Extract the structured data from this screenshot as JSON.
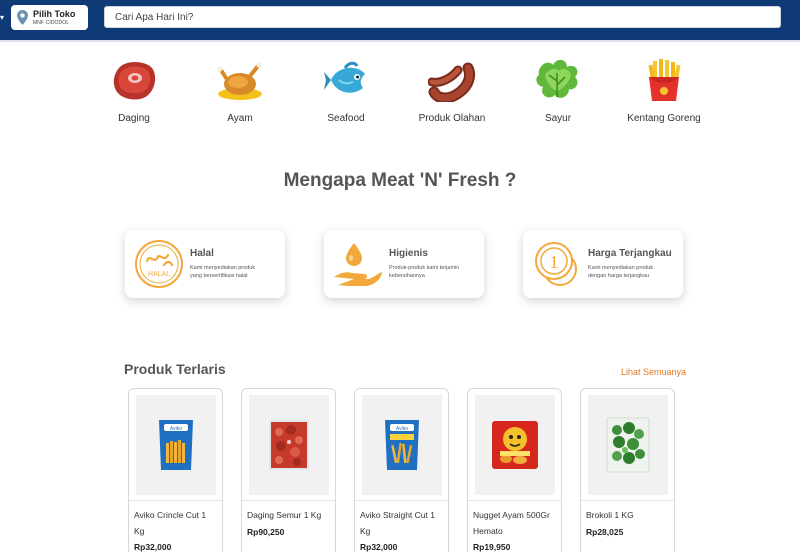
{
  "header": {
    "store_title": "Pilih Toko",
    "store_subtitle": "MNF CIDODOL",
    "search_placeholder": "Cari Apa Hari Ini?",
    "brand_color": "#0e3a75"
  },
  "categories": [
    {
      "label": "Daging",
      "icon": "meat-steak-icon"
    },
    {
      "label": "Ayam",
      "icon": "roast-chicken-icon"
    },
    {
      "label": "Seafood",
      "icon": "fish-icon"
    },
    {
      "label": "Produk Olahan",
      "icon": "sausage-icon"
    },
    {
      "label": "Sayur",
      "icon": "lettuce-icon"
    },
    {
      "label": "Kentang Goreng",
      "icon": "french-fries-icon"
    }
  ],
  "why": {
    "title": "Mengapa Meat 'N' Fresh ?",
    "features": [
      {
        "title": "Halal",
        "desc": "Kami menyediakan produk yang bersertifikasi halal",
        "icon": "halal-badge-icon"
      },
      {
        "title": "Higienis",
        "desc": "Produk-produk kami terjamin kebersihannya",
        "icon": "hand-drop-icon"
      },
      {
        "title": "Harga Terjangkau",
        "desc": "Kami menyediakan produk dengan harga terjangkau",
        "icon": "coins-icon"
      }
    ],
    "accent_color": "#f2a83a"
  },
  "products_section": {
    "title": "Produk Terlaris",
    "see_all": "Lihat Semuanya",
    "see_all_color": "#e07b22",
    "items": [
      {
        "name": "Aviko Crincle Cut 1 Kg",
        "price": "Rp32,000",
        "image": "aviko-crinkle-pack"
      },
      {
        "name": "Daging Semur 1 Kg",
        "price": "Rp90,250",
        "image": "beef-stew-pack"
      },
      {
        "name": "Aviko Straight Cut 1 Kg",
        "price": "Rp32,000",
        "image": "aviko-straight-pack"
      },
      {
        "name": "Nugget Ayam 500Gr Hemato",
        "price": "Rp19,950",
        "image": "nugget-hemato-pack"
      },
      {
        "name": "Brokoli 1 KG",
        "price": "Rp28,025",
        "image": "broccoli-pack"
      }
    ]
  }
}
